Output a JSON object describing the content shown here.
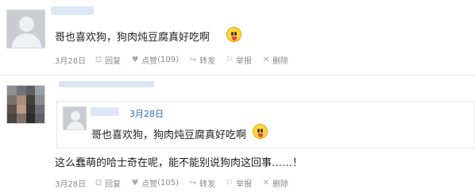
{
  "comment1": {
    "text": "哥也喜欢狗，狗肉炖豆腐真好吃啊",
    "date": "3月28日",
    "reply": "回复",
    "like": "点赞",
    "like_count": "(109)",
    "forward": "转发",
    "report": "举报",
    "delete": "删除"
  },
  "comment2": {
    "quote": {
      "date": "3月28日",
      "text": "哥也喜欢狗，狗肉炖豆腐真好吃啊"
    },
    "text": "这么蠢萌的哈士奇在呢，能不能别说狗肉这回事……！",
    "date": "3月28日",
    "reply": "回复",
    "like": "点赞",
    "like_count": "(105)",
    "forward": "转发",
    "report": "举报",
    "delete": "删除"
  },
  "colors": {
    "link": "#2b6cb3",
    "meta": "#8a8a8a",
    "divider": "#e6e6e6"
  },
  "icons": [
    "emoji-tongue-icon",
    "reply-icon",
    "thumbs-up-icon",
    "forward-icon",
    "report-icon",
    "delete-icon"
  ]
}
